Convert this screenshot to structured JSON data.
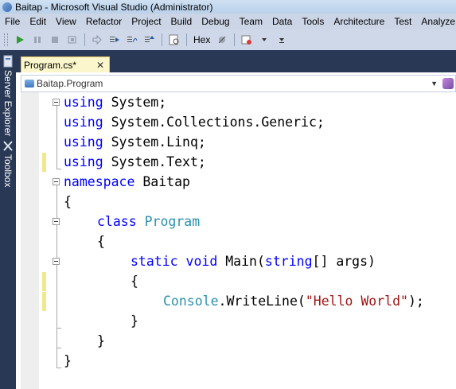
{
  "window": {
    "title": "Baitap - Microsoft Visual Studio (Administrator)"
  },
  "menu": [
    "File",
    "Edit",
    "View",
    "Refactor",
    "Project",
    "Build",
    "Debug",
    "Team",
    "Data",
    "Tools",
    "Architecture",
    "Test",
    "Analyze"
  ],
  "toolbar": {
    "hex_label": "Hex",
    "icons": [
      "start-debugging-icon",
      "break-all-icon",
      "stop-debugging-icon",
      "restart-icon",
      "show-next-statement-icon",
      "step-into-icon",
      "step-over-icon",
      "step-out-icon",
      "breakpoints-window-icon",
      "hex-toggle-icon",
      "remove-breakpoint-icon",
      "output-window-icon",
      "dropdown-icon"
    ]
  },
  "sidebar": {
    "server_explorer": "Server Explorer",
    "toolbox": "Toolbox"
  },
  "tab": {
    "label": "Program.cs*",
    "close": "✕"
  },
  "nav": {
    "class_selector": "Baitap.Program"
  },
  "code": {
    "l1": {
      "kw": "using",
      "rest": " System;"
    },
    "l2": {
      "kw": "using",
      "rest": " System.Collections.Generic;"
    },
    "l3": {
      "kw": "using",
      "rest": " System.Linq;"
    },
    "l4": {
      "kw": "using",
      "rest": " System.Text;"
    },
    "l5": {
      "kw": "namespace",
      "rest": " Baitap"
    },
    "l6": "{",
    "l7": {
      "kw": "class",
      "type": "Program"
    },
    "l8": "{",
    "l9": {
      "kw1": "static",
      "kw2": "void",
      "mid": " Main(",
      "kw3": "string",
      "rest": "[] args)"
    },
    "l10": "{",
    "l11": {
      "type": "Console",
      "mid": ".WriteLine(",
      "str": "\"Hello World\"",
      "rest": ");"
    },
    "l12": "}",
    "l13": "}",
    "l14": "}"
  },
  "colors": {
    "keyword": "#0000ff",
    "type": "#2b91af",
    "string": "#a31515",
    "change_marker": "#efe88d"
  }
}
